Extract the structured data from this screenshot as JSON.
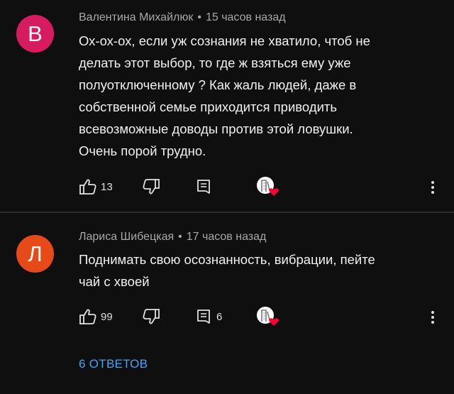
{
  "comments": [
    {
      "avatar_letter": "В",
      "avatar_color": "#d81b60",
      "author": "Валентина Михайлюк",
      "separator": "•",
      "time": "15 часов назад",
      "lines": [
        "Ох-ох-ох, если уж сознания не хватило, чтоб не",
        "делать этот выбор, то где ж взяться ему уже",
        "полуотключенному ? Как жаль людей, даже в",
        "собственной семье приходится приводить",
        "всевозможные доводы против этой ловушки.",
        "Очень порой трудно."
      ],
      "likes": "13",
      "replies_count": ""
    },
    {
      "avatar_letter": "Л",
      "avatar_color": "#e64a19",
      "author": "Лариса Шибецкая",
      "separator": "•",
      "time": "17 часов назад",
      "lines": [
        "Поднимать свою осознанность, вибрации, пейте",
        "чай с хвоей"
      ],
      "likes": "99",
      "replies_count": "6"
    }
  ],
  "replies_link": "6 ОТВЕТОВ",
  "icons": {
    "like": "thumbs-up-icon",
    "dislike": "thumbs-down-icon",
    "reply": "comment-icon",
    "creator_heart": "creator-heart-icon",
    "more": "more-vert-icon"
  },
  "colors": {
    "background": "#0f0f0f",
    "text": "#f1f1f1",
    "meta": "#a8a8a8",
    "link": "#3ea6ff",
    "heart": "#ff0033"
  }
}
